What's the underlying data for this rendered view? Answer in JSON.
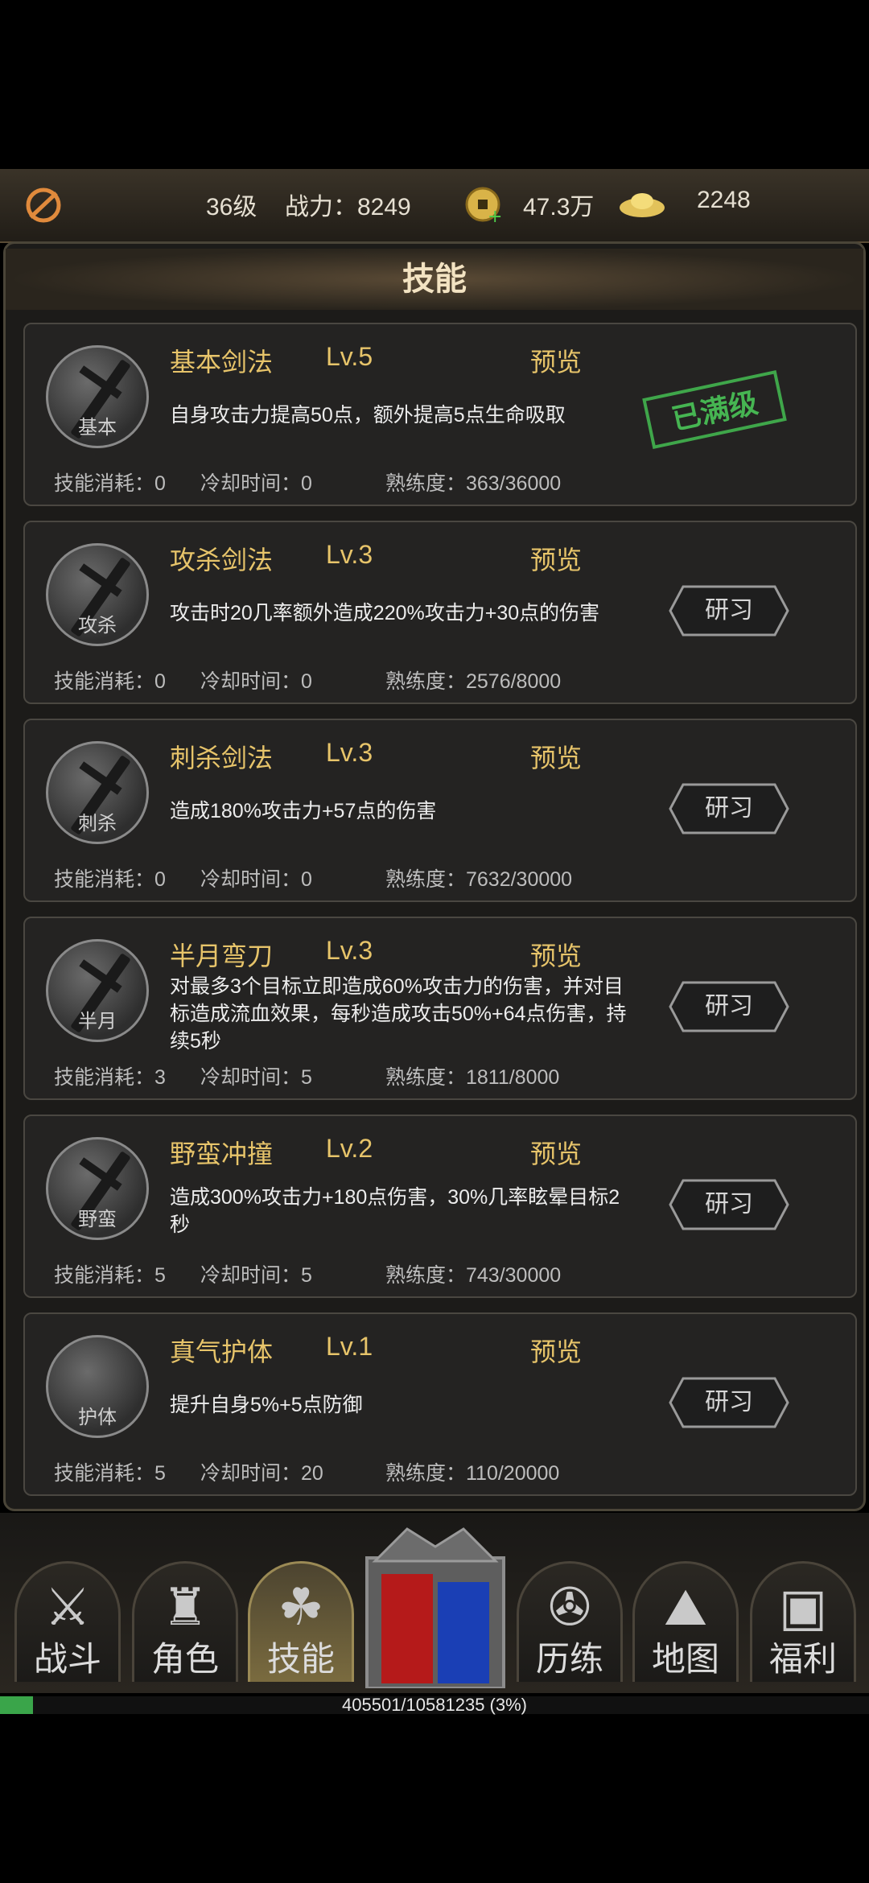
{
  "top_bar": {
    "level": "36级",
    "power_label": "战力：8249",
    "coins": "47.3万",
    "ingots": "2248"
  },
  "panel": {
    "title": "技能"
  },
  "skills": [
    {
      "name": "基本剑法",
      "level": "Lv.5",
      "preview": "预览",
      "icon_label": "基本",
      "description": "自身攻击力提高50点，额外提高5点生命吸取",
      "cost": "技能消耗：0",
      "cooldown": "冷却时间：0",
      "proficiency": "熟练度：363/36000",
      "status": "已满级"
    },
    {
      "name": "攻杀剑法",
      "level": "Lv.3",
      "preview": "预览",
      "icon_label": "攻杀",
      "description": "攻击时20几率额外造成220%攻击力+30点的伤害",
      "cost": "技能消耗：0",
      "cooldown": "冷却时间：0",
      "proficiency": "熟练度：2576/8000",
      "button": "研习"
    },
    {
      "name": "刺杀剑法",
      "level": "Lv.3",
      "preview": "预览",
      "icon_label": "刺杀",
      "description": "造成180%攻击力+57点的伤害",
      "cost": "技能消耗：0",
      "cooldown": "冷却时间：0",
      "proficiency": "熟练度：7632/30000",
      "button": "研习"
    },
    {
      "name": "半月弯刀",
      "level": "Lv.3",
      "preview": "预览",
      "icon_label": "半月",
      "description": "对最多3个目标立即造成60%攻击力的伤害，并对目标造成流血效果，每秒造成攻击50%+64点伤害，持续5秒",
      "cost": "技能消耗：3",
      "cooldown": "冷却时间：5",
      "proficiency": "熟练度：1811/8000",
      "button": "研习"
    },
    {
      "name": "野蛮冲撞",
      "level": "Lv.2",
      "preview": "预览",
      "icon_label": "野蛮",
      "description": "造成300%攻击力+180点伤害，30%几率眩晕目标2秒",
      "cost": "技能消耗：5",
      "cooldown": "冷却时间：5",
      "proficiency": "熟练度：743/30000",
      "button": "研习"
    },
    {
      "name": "真气护体",
      "level": "Lv.1",
      "preview": "预览",
      "icon_label": "护体",
      "description": "提升自身5%+5点防御",
      "cost": "技能消耗：5",
      "cooldown": "冷却时间：20",
      "proficiency": "熟练度：110/20000",
      "button": "研习"
    }
  ],
  "nav": [
    {
      "label": "战斗",
      "icon": "crossed-swords-icon"
    },
    {
      "label": "角色",
      "icon": "helmet-icon"
    },
    {
      "label": "技能",
      "icon": "triquetra-icon",
      "active": true
    },
    {
      "label": "历练",
      "icon": "triskele-icon"
    },
    {
      "label": "地图",
      "icon": "map-icon"
    },
    {
      "label": "福利",
      "icon": "chest-icon"
    }
  ],
  "progress": {
    "text": "405501/10581235 (3%)",
    "fraction": 0.038
  },
  "colors": {
    "gold": "#e7c46a",
    "green": "#46b552",
    "panel": "#1c1b19"
  }
}
